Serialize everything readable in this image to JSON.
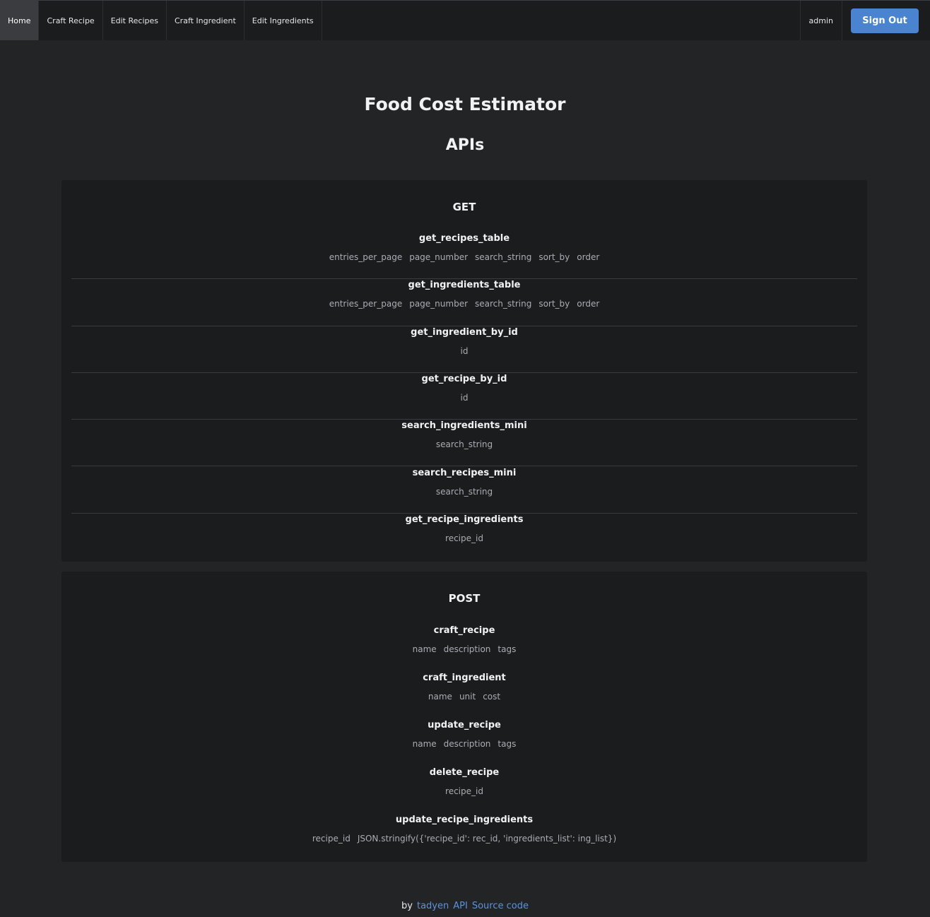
{
  "nav": {
    "items": [
      {
        "label": "Home",
        "active": true
      },
      {
        "label": "Craft Recipe",
        "active": false
      },
      {
        "label": "Edit Recipes",
        "active": false
      },
      {
        "label": "Craft Ingredient",
        "active": false
      },
      {
        "label": "Edit Ingredients",
        "active": false
      }
    ],
    "user": "admin",
    "signout_label": "Sign Out"
  },
  "page": {
    "title": "Food Cost Estimator",
    "subtitle": "APIs"
  },
  "get_section": {
    "heading": "GET",
    "endpoints": [
      {
        "name": "get_recipes_table",
        "params": [
          "entries_per_page",
          "page_number",
          "search_string",
          "sort_by",
          "order"
        ]
      },
      {
        "name": "get_ingredients_table",
        "params": [
          "entries_per_page",
          "page_number",
          "search_string",
          "sort_by",
          "order"
        ]
      },
      {
        "name": "get_ingredient_by_id",
        "params": [
          "id"
        ]
      },
      {
        "name": "get_recipe_by_id",
        "params": [
          "id"
        ]
      },
      {
        "name": "search_ingredients_mini",
        "params": [
          "search_string"
        ]
      },
      {
        "name": "search_recipes_mini",
        "params": [
          "search_string"
        ]
      },
      {
        "name": "get_recipe_ingredients",
        "params": [
          "recipe_id"
        ]
      }
    ]
  },
  "post_section": {
    "heading": "POST",
    "endpoints": [
      {
        "name": "craft_recipe",
        "params": [
          "name",
          "description",
          "tags"
        ]
      },
      {
        "name": "craft_ingredient",
        "params": [
          "name",
          "unit",
          "cost"
        ]
      },
      {
        "name": "update_recipe",
        "params": [
          "name",
          "description",
          "tags"
        ]
      },
      {
        "name": "delete_recipe",
        "params": [
          "recipe_id"
        ]
      },
      {
        "name": "update_recipe_ingredients",
        "params": [
          "recipe_id",
          "JSON.stringify({'recipe_id': rec_id, 'ingredients_list': ing_list})"
        ]
      }
    ]
  },
  "footer": {
    "by_text": "by",
    "author_link": "tadyen",
    "api_link": "API",
    "source_link": "Source code"
  },
  "colors": {
    "background": "#222426",
    "panel": "#1b1c1e",
    "accent": "#4a84d0",
    "link": "#5b94dc"
  }
}
